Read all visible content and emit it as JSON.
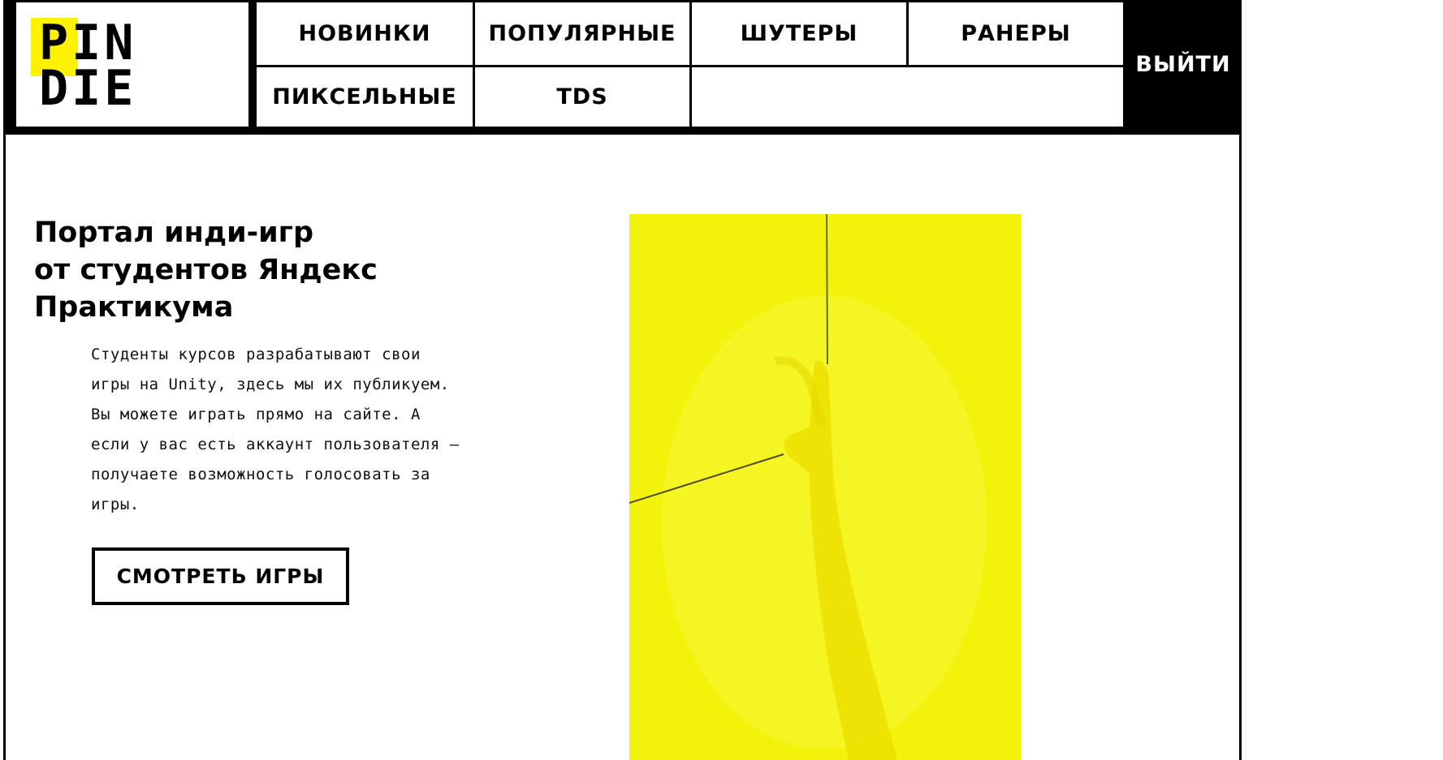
{
  "logo": {
    "line1": "PIN",
    "line2": "DIE"
  },
  "nav": {
    "row1": [
      "НОВИНКИ",
      "ПОПУЛЯРНЫЕ",
      "ШУТЕРЫ",
      "РАНЕРЫ"
    ],
    "row2": [
      "ПИКСЕЛЬНЫЕ",
      "TDS"
    ],
    "logout": "ВЫЙТИ"
  },
  "hero": {
    "title_lines": [
      "Портал инди-игр",
      "от студентов Яндекс",
      "Практикума"
    ],
    "text_lines": [
      "Студенты курсов разрабатывают свои",
      "игры на Unity, здесь мы их публикуем.",
      "Вы можете играть прямо на сайте. А",
      "если у вас есть аккаунт пользователя —",
      "получаете возможность голосовать за",
      "игры."
    ],
    "button": "СМОТРЕТЬ ИГРЫ"
  },
  "colors": {
    "accent": "#fff200",
    "image_bg": "#f2f20a",
    "frame": "#000000"
  }
}
